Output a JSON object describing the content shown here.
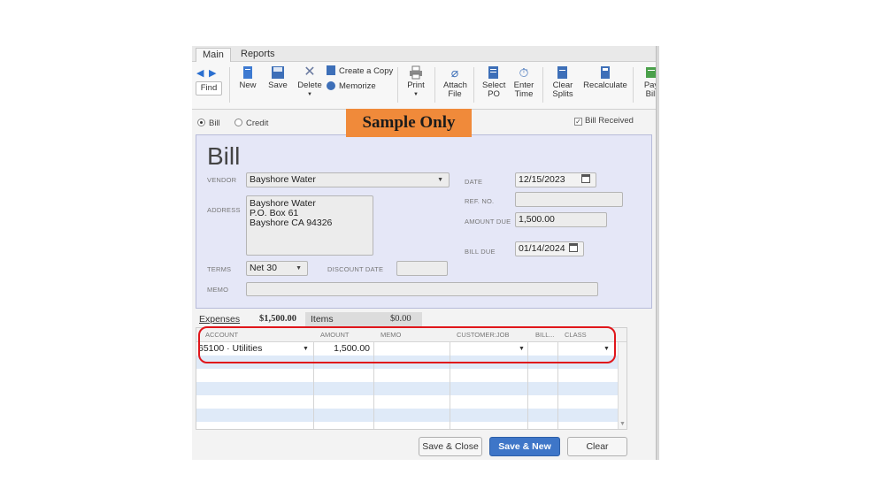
{
  "tabs": [
    "Main",
    "Reports"
  ],
  "toolbar": {
    "find": "Find",
    "new": "New",
    "save": "Save",
    "delete": "Delete",
    "create_copy": "Create a Copy",
    "memorize": "Memorize",
    "print": "Print",
    "attach": [
      "Attach",
      "File"
    ],
    "select_po": [
      "Select",
      "PO"
    ],
    "enter_time": [
      "Enter",
      "Time"
    ],
    "clear_splits": [
      "Clear",
      "Splits"
    ],
    "recalculate": "Recalculate",
    "pay_bill": [
      "Pay",
      "Bill"
    ]
  },
  "mode": {
    "bill": "Bill",
    "credit": "Credit",
    "selected": "bill",
    "bill_received": "Bill Received",
    "bill_received_checked": true
  },
  "watermark": "Sample Only",
  "form": {
    "title": "Bill",
    "vendor_label": "VENDOR",
    "vendor": "Bayshore Water",
    "address_label": "ADDRESS",
    "address_lines": [
      "Bayshore Water",
      "P.O. Box 61",
      "Bayshore CA 94326"
    ],
    "terms_label": "TERMS",
    "terms": "Net 30",
    "discount_date_label": "DISCOUNT DATE",
    "discount_date": "",
    "memo_label": "MEMO",
    "memo": "",
    "date_label": "DATE",
    "date": "12/15/2023",
    "ref_label": "REF. NO.",
    "ref": "",
    "amount_due_label": "AMOUNT DUE",
    "amount_due": "1,500.00",
    "bill_due_label": "BILL DUE",
    "bill_due": "01/14/2024"
  },
  "detail_tabs": {
    "expenses_label": "Expenses",
    "expenses_total": "$1,500.00",
    "items_label": "Items",
    "items_total": "$0.00"
  },
  "grid": {
    "headers": [
      "ACCOUNT",
      "AMOUNT",
      "MEMO",
      "CUSTOMER:JOB",
      "BILL...",
      "CLASS"
    ],
    "rows": [
      {
        "account": "65100 · Utilities",
        "amount": "1,500.00",
        "memo": "",
        "customer_job": "",
        "billable": "",
        "class": ""
      }
    ]
  },
  "buttons": {
    "save_close": "Save & Close",
    "save_new": "Save & New",
    "clear": "Clear"
  },
  "colors": {
    "form_bg": "#e5e7f7",
    "watermark_bg": "#f08a3a",
    "highlight": "#e0161b",
    "primary_button": "#3e76c8"
  }
}
